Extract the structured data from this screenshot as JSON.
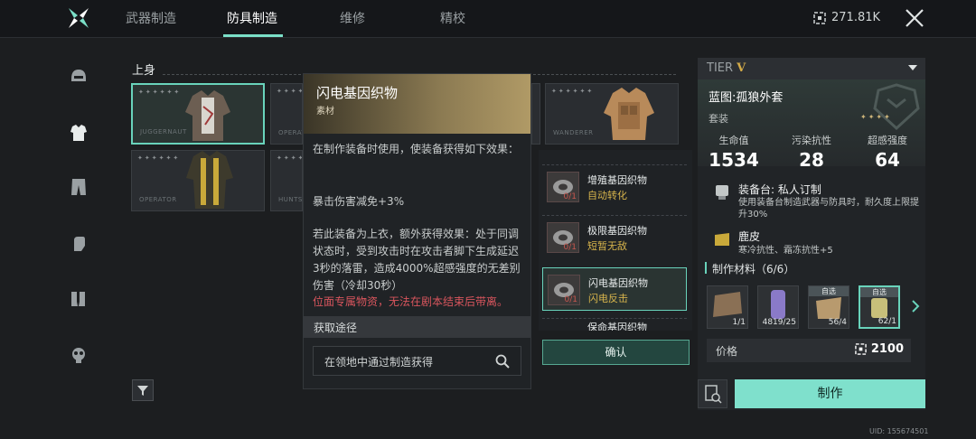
{
  "tabs": [
    {
      "label": "武器制造",
      "active": false
    },
    {
      "label": "防具制造",
      "active": true
    },
    {
      "label": "维修",
      "active": false
    },
    {
      "label": "精校",
      "active": false
    }
  ],
  "currency": {
    "value": "271.81K"
  },
  "sidebar": {
    "items": [
      {
        "icon": "helmet-icon"
      },
      {
        "icon": "armor-icon"
      },
      {
        "icon": "pants-icon"
      },
      {
        "icon": "gloves-icon"
      },
      {
        "icon": "boots-icon"
      },
      {
        "icon": "gas-mask-icon"
      }
    ]
  },
  "section": {
    "title": "上身"
  },
  "cards": [
    {
      "name": "JUGGERNAUT",
      "stars": "✦✦✦✦✦✦",
      "selected": true
    },
    {
      "name": "OPERATO",
      "stars": "✦✦✦✦✦✦",
      "selected": false
    },
    {
      "name": "WANDERER",
      "stars": "✦✦✦✦✦✦",
      "selected": false
    },
    {
      "name": "OPERATOR",
      "stars": "✦✦✦✦✦✦",
      "selected": false
    },
    {
      "name": "HUNTS",
      "stars": "✦✦✦✦✦✦",
      "selected": false
    }
  ],
  "tooltip": {
    "title": "闪电基因织物",
    "subtitle": "素材",
    "desc1": "在制作装备时使用，使装备获得如下效果：",
    "desc2": "暴击伤害减免+3%",
    "desc3": "若此装备为上衣，额外获得效果：处于同调状态时，受到攻击时在攻击者脚下生成延迟3秒的落雷，造成4000%超感强度的无差别伤害（冷却30秒）",
    "warning": "位面专属物资，无法在剧本结束后带离。",
    "acq_title": "获取途径",
    "acq_text": "在领地中通过制造获得"
  },
  "materials": [
    {
      "name": "增殖基因织物",
      "effect": "自动转化",
      "count": "0/1",
      "selected": false
    },
    {
      "name": "极限基因织物",
      "effect": "短暂无敌",
      "count": "0/1",
      "selected": false
    },
    {
      "name": "闪电基因织物",
      "effect": "闪电反击",
      "count": "0/1",
      "selected": true
    },
    {
      "name": "保命基因织物",
      "effect": "",
      "count": "",
      "selected": false
    }
  ],
  "confirm_label": "确认",
  "blueprint": {
    "tier_label": "TIER",
    "tier_roman": "V",
    "title": "蓝图:孤狼外套",
    "type": "套装",
    "stars": "✦✦✦✦",
    "stats": [
      {
        "label": "生命值",
        "value": "1534"
      },
      {
        "label": "污染抗性",
        "value": "28"
      },
      {
        "label": "超感强度",
        "value": "64"
      }
    ],
    "feature1": {
      "title": "装备台: 私人订制",
      "desc": "使用装备台制造武器与防具时，耐久度上限提升30%"
    },
    "feature2": {
      "title": "鹿皮",
      "desc": "寒冷抗性、霜冻抗性+5"
    },
    "mats_header": "制作材料（6/6）",
    "mats": [
      {
        "qty": "1/1",
        "tag": ""
      },
      {
        "qty": "4819/25",
        "tag": ""
      },
      {
        "qty": "56/4",
        "tag": "自选"
      },
      {
        "qty": "62/1",
        "tag": "自选"
      }
    ],
    "price_label": "价格",
    "price_value": "2100"
  },
  "craft_label": "制作",
  "uid": "UID: 155674501",
  "colors": {
    "accent": "#7fe0cc",
    "gold": "#d4ab48",
    "warning": "#d8555d",
    "effect": "#d7b44c"
  }
}
